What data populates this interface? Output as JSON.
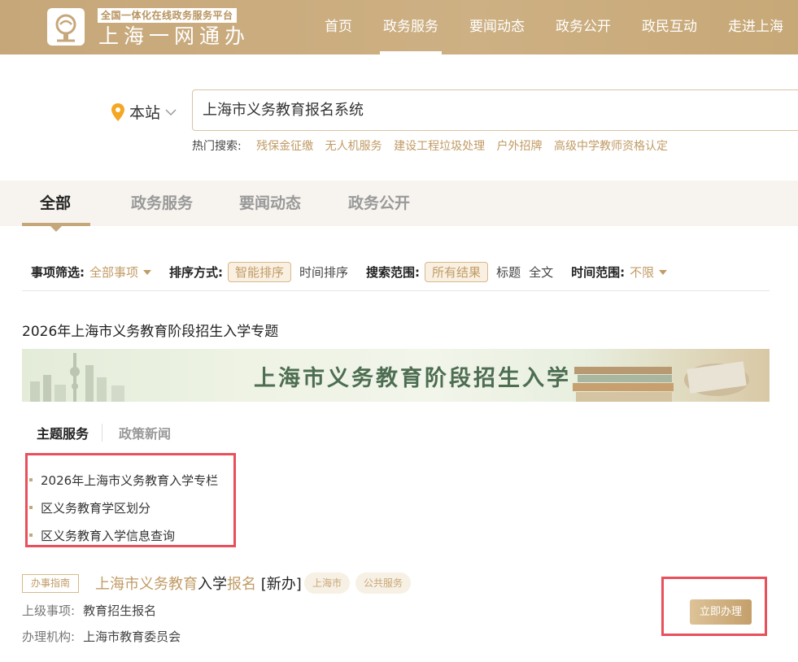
{
  "header": {
    "logo_subtitle": "全国一体化在线政务服务平台",
    "logo_title": "上海一网通办",
    "nav": [
      {
        "label": "首页",
        "active": false
      },
      {
        "label": "政务服务",
        "active": true
      },
      {
        "label": "要闻动态",
        "active": false
      },
      {
        "label": "政务公开",
        "active": false
      },
      {
        "label": "政民互动",
        "active": false
      },
      {
        "label": "走进上海",
        "active": false
      }
    ]
  },
  "search": {
    "scope": "本站",
    "query": "上海市义务教育报名系统",
    "hot_label": "热门搜索:",
    "hot_items": [
      "残保金征缴",
      "无人机服务",
      "建设工程垃圾处理",
      "户外招牌",
      "高级中学教师资格认定"
    ]
  },
  "tabs": [
    "全部",
    "政务服务",
    "要闻动态",
    "政务公开"
  ],
  "filters": {
    "item_label": "事项筛选:",
    "item_value": "全部事项",
    "sort_label": "排序方式:",
    "sort_options": [
      "智能排序",
      "时间排序"
    ],
    "range_label": "搜索范围:",
    "range_options": [
      "所有结果",
      "标题",
      "全文"
    ],
    "time_label": "时间范围:",
    "time_value": "不限"
  },
  "topic": {
    "title": "2026年上海市义务教育阶段招生入学专题",
    "banner_text": "上海市义务教育阶段招生入学",
    "sub_tabs": [
      "主题服务",
      "政策新闻"
    ],
    "services": [
      "2026年上海市义务教育入学专栏",
      "区义务教育学区划分",
      "区义务教育入学信息查询"
    ]
  },
  "result": {
    "tag": "办事指南",
    "title_parts": [
      "上海市义务教育",
      "入学",
      "报名",
      " [新办]"
    ],
    "pills": [
      "上海市",
      "公共服务"
    ],
    "parent_label": "上级事项:",
    "parent_value": "教育招生报名",
    "org_label": "办理机构:",
    "org_value": "上海市教育委员会",
    "apply_label": "立即办理"
  },
  "colors": {
    "brand": "#c6a779",
    "highlight": "#e8505b"
  }
}
